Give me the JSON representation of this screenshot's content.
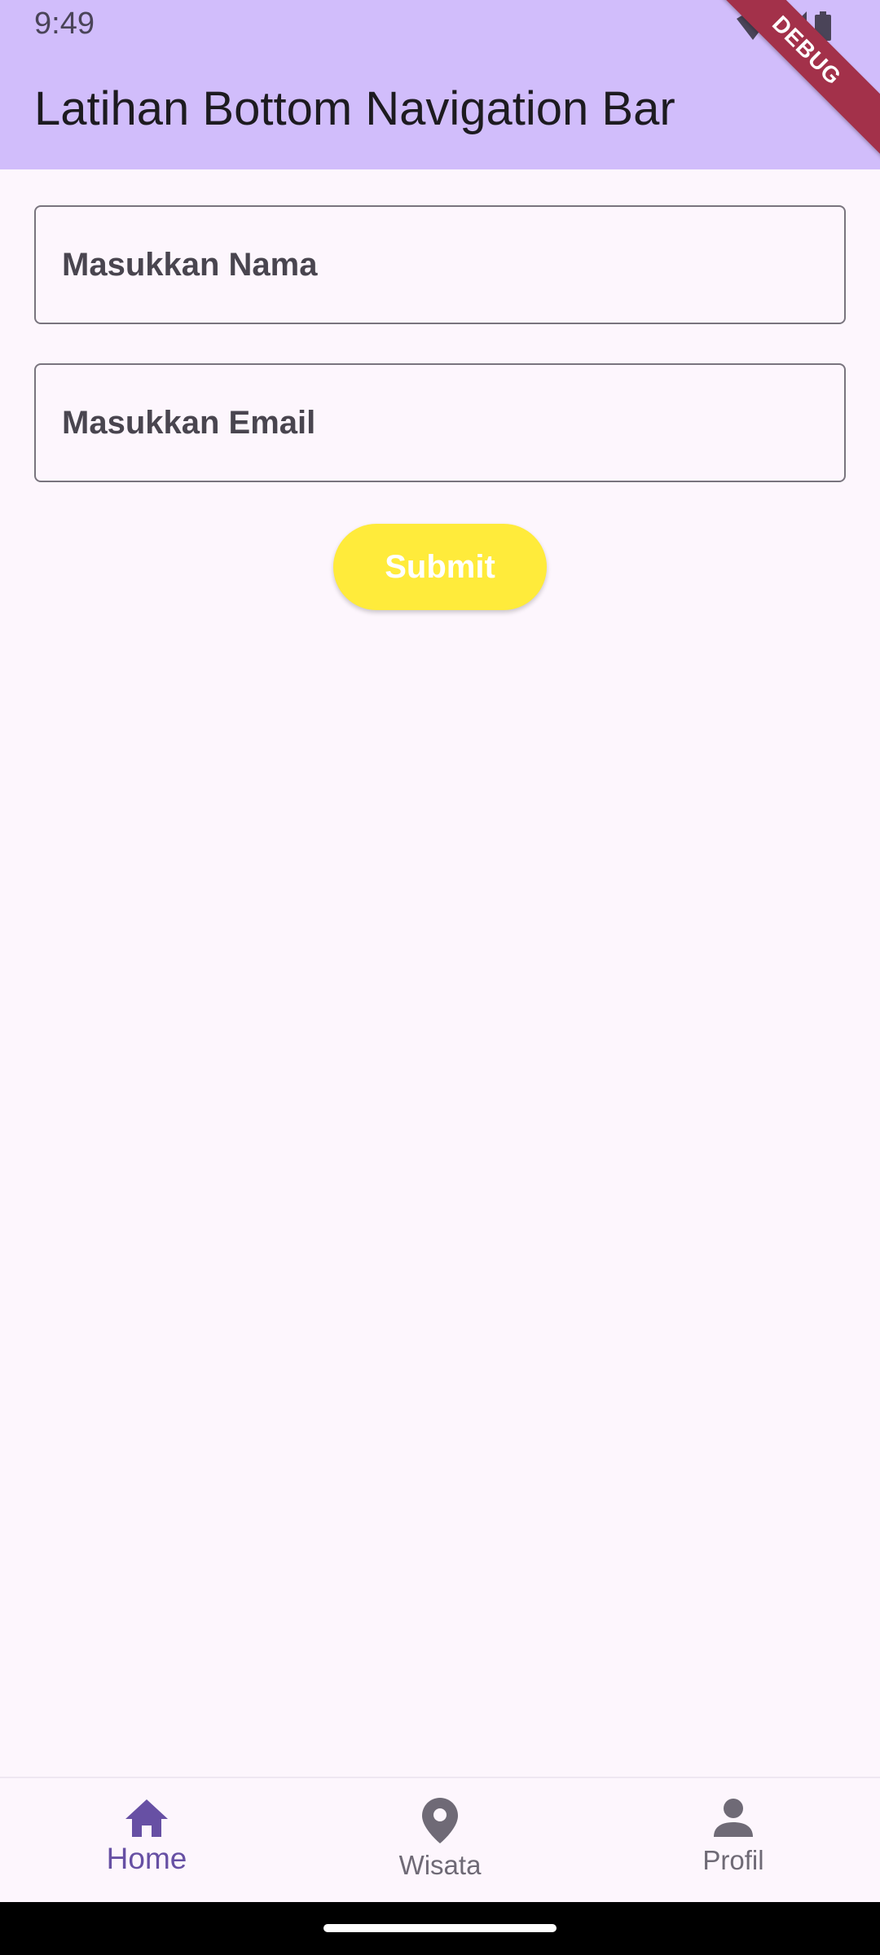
{
  "status_bar": {
    "time": "9:49"
  },
  "app_bar": {
    "title": "Latihan Bottom Navigation Bar"
  },
  "debug_banner": "DEBUG",
  "form": {
    "name_placeholder": "Masukkan Nama",
    "email_placeholder": "Masukkan Email",
    "submit_label": "Submit"
  },
  "bottom_nav": {
    "items": [
      {
        "label": "Home",
        "icon": "home-icon",
        "active": true
      },
      {
        "label": "Wisata",
        "icon": "location-pin-icon",
        "active": false
      },
      {
        "label": "Profil",
        "icon": "person-icon",
        "active": false
      }
    ]
  },
  "colors": {
    "app_bar": "#d1bdfb",
    "background": "#fdf6fd",
    "submit_button": "#ffeb3b",
    "active_nav": "#6750a4",
    "inactive_nav": "#6f6a76",
    "debug_ribbon": "#a3314a"
  }
}
